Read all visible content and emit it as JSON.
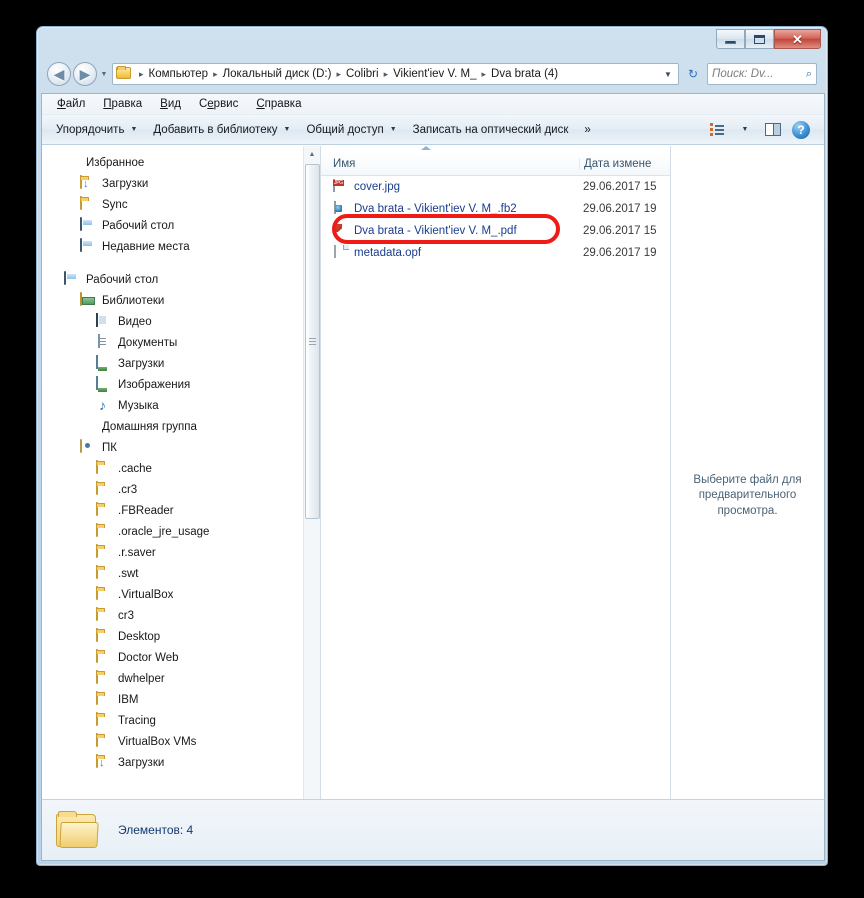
{
  "window": {
    "controls": {
      "minimize_label": "—",
      "maximize_label": "",
      "close_label": "✕"
    }
  },
  "address_bar": {
    "back_label": "◀",
    "forward_label": "▶",
    "history_label": "▼",
    "dropdown_label": "▼",
    "refresh_label": "↻",
    "crumbs": [
      "Компьютер",
      "Локальный диск (D:)",
      "Colibri",
      "Vikient'iev V. M_",
      "Dva brata (4)"
    ],
    "separator": "▸"
  },
  "search": {
    "placeholder": "Поиск: Dv...",
    "icon_label": "⌕"
  },
  "menu": {
    "items": [
      {
        "prefix": "",
        "accel": "Ф",
        "rest": "айл"
      },
      {
        "prefix": "",
        "accel": "П",
        "rest": "равка"
      },
      {
        "prefix": "",
        "accel": "В",
        "rest": "ид"
      },
      {
        "prefix": "С",
        "accel": "е",
        "rest": "рвис"
      },
      {
        "prefix": "",
        "accel": "С",
        "rest": "правка"
      }
    ]
  },
  "toolbar": {
    "organize": "Упорядочить",
    "add_to_library": "Добавить в библиотеку",
    "share": "Общий доступ",
    "burn": "Записать на оптический диск",
    "overflow": "»",
    "caret": "▼",
    "help_label": "?"
  },
  "sidebar": {
    "items": [
      {
        "label": "Избранное",
        "icon": "star-icon",
        "indent": 0
      },
      {
        "label": "Загрузки",
        "icon": "downloads-folder-icon",
        "indent": 1
      },
      {
        "label": "Sync",
        "icon": "folder-icon",
        "indent": 1
      },
      {
        "label": "Рабочий стол",
        "icon": "desktop-icon",
        "indent": 1
      },
      {
        "label": "Недавние места",
        "icon": "recent-places-icon",
        "indent": 1
      },
      {
        "label": "",
        "icon": "gap",
        "indent": 0
      },
      {
        "label": "Рабочий стол",
        "icon": "desktop-icon",
        "indent": 0
      },
      {
        "label": "Библиотеки",
        "icon": "libraries-icon",
        "indent": 1
      },
      {
        "label": "Видео",
        "icon": "video-icon",
        "indent": 2
      },
      {
        "label": "Документы",
        "icon": "documents-icon",
        "indent": 2
      },
      {
        "label": "Загрузки",
        "icon": "downloads-library-icon",
        "indent": 2
      },
      {
        "label": "Изображения",
        "icon": "pictures-icon",
        "indent": 2
      },
      {
        "label": "Музыка",
        "icon": "music-icon",
        "indent": 2
      },
      {
        "label": "Домашняя группа",
        "icon": "homegroup-icon",
        "indent": 1
      },
      {
        "label": "ПК",
        "icon": "user-folder-icon",
        "indent": 1
      },
      {
        "label": ".cache",
        "icon": "folder-icon",
        "indent": 2
      },
      {
        "label": ".cr3",
        "icon": "folder-icon",
        "indent": 2
      },
      {
        "label": ".FBReader",
        "icon": "folder-icon",
        "indent": 2
      },
      {
        "label": ".oracle_jre_usage",
        "icon": "folder-icon",
        "indent": 2
      },
      {
        "label": ".r.saver",
        "icon": "folder-icon",
        "indent": 2
      },
      {
        "label": ".swt",
        "icon": "folder-icon",
        "indent": 2
      },
      {
        "label": ".VirtualBox",
        "icon": "folder-icon",
        "indent": 2
      },
      {
        "label": "cr3",
        "icon": "folder-icon",
        "indent": 2
      },
      {
        "label": "Desktop",
        "icon": "folder-icon",
        "indent": 2
      },
      {
        "label": "Doctor Web",
        "icon": "folder-icon",
        "indent": 2
      },
      {
        "label": "dwhelper",
        "icon": "folder-icon",
        "indent": 2
      },
      {
        "label": "IBM",
        "icon": "folder-icon",
        "indent": 2
      },
      {
        "label": "Tracing",
        "icon": "folder-icon",
        "indent": 2
      },
      {
        "label": "VirtualBox VMs",
        "icon": "folder-icon",
        "indent": 2
      },
      {
        "label": "Загрузки",
        "icon": "downloads-folder-icon",
        "indent": 2
      }
    ],
    "scroll_up_label": "▲",
    "scroll_down_label": "▼"
  },
  "file_list": {
    "columns": {
      "name": "Имя",
      "date_modified": "Дата измене"
    },
    "rows": [
      {
        "name": "cover.jpg",
        "icon": "jpg-file-icon",
        "date": "29.06.2017 15"
      },
      {
        "name": "Dva brata - Vikient'iev V. M_.fb2",
        "icon": "fb2-file-icon",
        "date": "29.06.2017 19"
      },
      {
        "name": "Dva brata - Vikient'iev V. M_.pdf",
        "icon": "pdf-file-icon",
        "date": "29.06.2017 15"
      },
      {
        "name": "metadata.opf",
        "icon": "opf-file-icon",
        "date": "29.06.2017 19"
      }
    ],
    "scroll_left_label": "◀",
    "scroll_right_label": "▶"
  },
  "preview_pane": {
    "message": "Выберите файл для предварительного просмотра."
  },
  "status_bar": {
    "items_count": "Элементов: 4"
  },
  "annotation": {
    "color": "#ee1b17",
    "target": "Dva brata - Vikient'iev V. M_.fb2"
  }
}
